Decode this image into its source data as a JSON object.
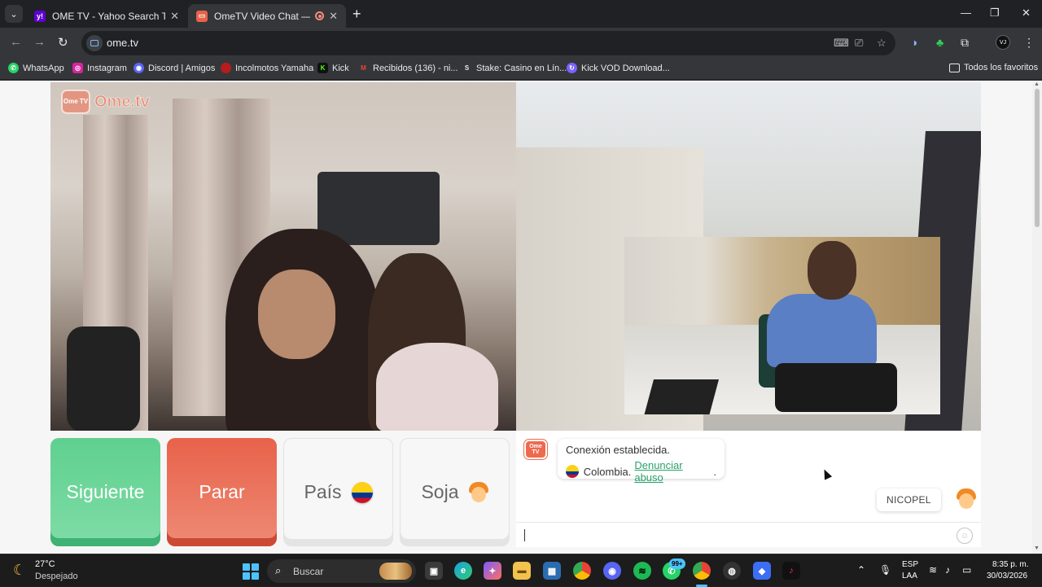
{
  "browser": {
    "tabs": [
      {
        "title": "OME TV - Yahoo Search Tus res",
        "favicon": "yahoo-icon",
        "active": false
      },
      {
        "title": "OmeTV Video Chat — Alter",
        "favicon": "ometv-icon",
        "active": true,
        "recording": true
      }
    ],
    "url": "ome.tv",
    "bookmarks": [
      {
        "label": "WhatsApp",
        "icon": "whatsapp-icon",
        "color": "#25d366"
      },
      {
        "label": "Instagram",
        "icon": "instagram-icon",
        "color": "#d6249f"
      },
      {
        "label": "Discord | Amigos",
        "icon": "discord-icon",
        "color": "#5865f2"
      },
      {
        "label": "Incolmotos Yamaha",
        "icon": "yamaha-icon",
        "color": "#b71c1c"
      },
      {
        "label": "Kick",
        "icon": "kick-icon",
        "color": "#53fc18"
      },
      {
        "label": "Recibidos (136) - ni...",
        "icon": "gmail-icon",
        "color": "#ea4335"
      },
      {
        "label": "Stake: Casino en Lín...",
        "icon": "stake-icon",
        "color": "#1a2c38"
      },
      {
        "label": "Kick VOD Download...",
        "icon": "kick-vod-icon",
        "color": "#7b61ff"
      }
    ],
    "all_bookmarks": "Todos los favoritos",
    "profile_initials": "VJ"
  },
  "ome": {
    "logo_text": "Ome.tv",
    "logo_badge": "Ome TV",
    "buttons": {
      "next": "Siguiente",
      "stop": "Parar",
      "country": "País",
      "gender": "Soja"
    },
    "chat": {
      "system_line1": "Conexión establecida.",
      "country": "Colombia",
      "separator": " .",
      "report": "Denunciar abuso",
      "report_end": ".",
      "partner_name": "NICOPEL",
      "input_value": ""
    },
    "colors": {
      "next": "#5fd08f",
      "stop": "#e8624a",
      "link": "#2aa06a"
    }
  },
  "taskbar": {
    "temperature": "27°C",
    "weather": "Despejado",
    "search_label": "Buscar",
    "notification_badge": "99+",
    "lang1": "ESP",
    "lang2": "LAA",
    "time": "8:35 p. m.",
    "date": "30/03/2026"
  }
}
